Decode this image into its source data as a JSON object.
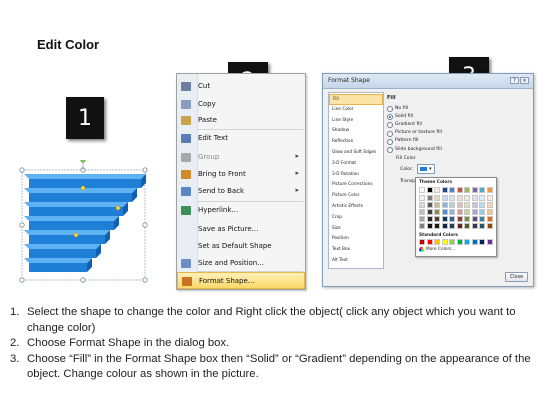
{
  "title": "Edit Color",
  "badges": [
    "1",
    "2",
    "3"
  ],
  "context_menu": {
    "items": [
      {
        "label": "Cut",
        "icon": "scissors-icon",
        "color": "#6b7fa3",
        "disabled": false,
        "submenu": false
      },
      {
        "label": "Copy",
        "icon": "copy-icon",
        "color": "#8a9cc0",
        "disabled": false,
        "submenu": false
      },
      {
        "label": "Paste",
        "icon": "paste-icon",
        "color": "#c9a24a",
        "disabled": false,
        "submenu": false
      },
      {
        "label": "Edit Text",
        "icon": "edit-text-icon",
        "color": "#5a7bb5",
        "disabled": false,
        "submenu": false
      },
      {
        "label": "Group",
        "icon": "group-icon",
        "color": "#a8a8a8",
        "disabled": true,
        "submenu": true
      },
      {
        "label": "Bring to Front",
        "icon": "bring-to-front-icon",
        "color": "#d08a2a",
        "disabled": false,
        "submenu": true
      },
      {
        "label": "Send to Back",
        "icon": "send-to-back-icon",
        "color": "#5b86c4",
        "disabled": false,
        "submenu": true
      },
      {
        "label": "Hyperlink...",
        "icon": "hyperlink-icon",
        "color": "#3d8f5a",
        "disabled": false,
        "submenu": false
      },
      {
        "label": "Save as Picture...",
        "icon": "",
        "color": "",
        "disabled": false,
        "submenu": false
      },
      {
        "label": "Set as Default Shape",
        "icon": "",
        "color": "",
        "disabled": false,
        "submenu": false
      },
      {
        "label": "Size and Position...",
        "icon": "size-position-icon",
        "color": "#6c8ec4",
        "disabled": false,
        "submenu": false
      },
      {
        "label": "Format Shape...",
        "icon": "format-shape-icon",
        "color": "#c7731f",
        "disabled": false,
        "submenu": false
      }
    ]
  },
  "dialog": {
    "title": "Format Shape",
    "categories": [
      "Fill",
      "Line Color",
      "Line Style",
      "Shadow",
      "Reflection",
      "Glow and Soft Edges",
      "3-D Format",
      "3-D Rotation",
      "Picture Corrections",
      "Picture Color",
      "Artistic Effects",
      "Crop",
      "Size",
      "Position",
      "Text Box",
      "Alt Text"
    ],
    "selected_category": "Fill",
    "fill_heading": "Fill",
    "options": [
      "No fill",
      "Solid fill",
      "Gradient fill",
      "Picture or texture fill",
      "Pattern fill",
      "Slide background fill"
    ],
    "selected_option": "Solid fill",
    "fill_color_heading": "Fill Color",
    "color_label": "Color:",
    "transparency_label": "Transpa",
    "palette": {
      "theme_label": "Theme Colors",
      "standard_label": "Standard Colors",
      "more_label": "More Colors...",
      "theme_top": [
        "#ffffff",
        "#000000",
        "#eeece1",
        "#1f497d",
        "#4f81bd",
        "#c0504d",
        "#9bbb59",
        "#8064a2",
        "#4bacc6",
        "#f79646"
      ],
      "theme_columns": [
        [
          "#f2f2f2",
          "#d9d9d9",
          "#bfbfbf",
          "#a6a6a6",
          "#7f7f7f"
        ],
        [
          "#7f7f7f",
          "#595959",
          "#404040",
          "#262626",
          "#0d0d0d"
        ],
        [
          "#ddd9c3",
          "#c4bd97",
          "#938953",
          "#494429",
          "#1d1b10"
        ],
        [
          "#c6d9f0",
          "#8db3e2",
          "#548dd4",
          "#17365d",
          "#0f243e"
        ],
        [
          "#dbe5f1",
          "#b8cce4",
          "#95b3d7",
          "#366092",
          "#244061"
        ],
        [
          "#f2dcdb",
          "#e5b9b7",
          "#d99694",
          "#953734",
          "#632423"
        ],
        [
          "#ebf1dd",
          "#d7e3bc",
          "#c3d69b",
          "#76923c",
          "#4f6128"
        ],
        [
          "#e5e0ec",
          "#ccc1d9",
          "#b2a2c7",
          "#5f497a",
          "#3f3151"
        ],
        [
          "#dbeef3",
          "#b7dde8",
          "#92cddc",
          "#31859b",
          "#205867"
        ],
        [
          "#fdeada",
          "#fbd5b5",
          "#fac08f",
          "#e36c09",
          "#974806"
        ]
      ],
      "standard": [
        "#c00000",
        "#ff0000",
        "#ffc000",
        "#ffff00",
        "#92d050",
        "#00b050",
        "#00b0f0",
        "#0070c0",
        "#002060",
        "#7030a0"
      ]
    },
    "close_label": "Close"
  },
  "steps": [
    {
      "num": "1.",
      "text": "Select the shape to change the color and Right click the object( click any object which you want to change color)"
    },
    {
      "num": "2.",
      "text": "Choose Format Shape in the dialog box."
    },
    {
      "num": "3.",
      "text": "Choose “Fill” in the Format Shape box then “Solid” or “Gradient” depending on the appearance of the object. Change colour as shown in the picture."
    }
  ],
  "colors": {
    "shape_top": "#5fb3f2",
    "shape_front": "#1f7fd6",
    "shape_side": "#0f5fb3",
    "highlight": "#fbd86a"
  }
}
